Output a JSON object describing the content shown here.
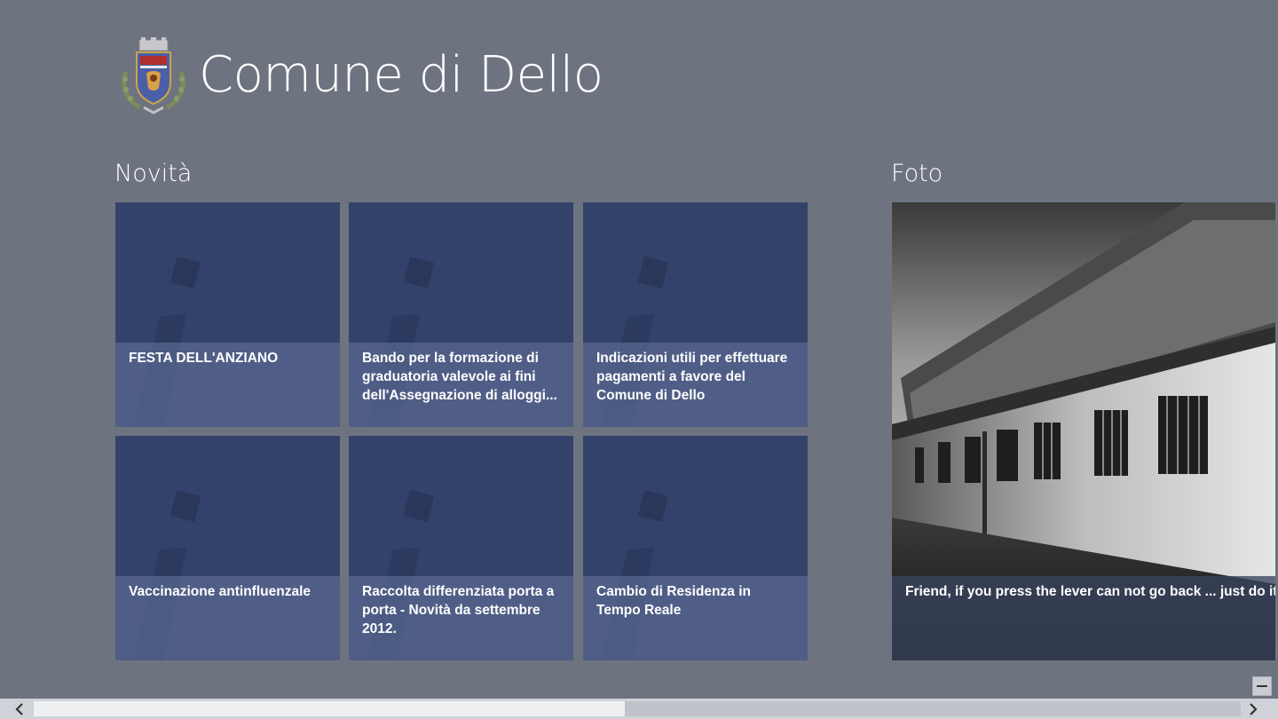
{
  "app": {
    "title": "Comune di Dello"
  },
  "sections": {
    "news": {
      "title": "Novità",
      "items": [
        {
          "title": "FESTA DELL'ANZIANO"
        },
        {
          "title": "Bando per la formazione di graduatoria valevole ai fini dell'Assegnazione di alloggi..."
        },
        {
          "title": "Indicazioni utili per effettuare pagamenti a favore del Comune di Dello"
        },
        {
          "title": "Vaccinazione antinfluenzale"
        },
        {
          "title": "Raccolta differenziata porta a porta - Novità da settembre 2012."
        },
        {
          "title": "Cambio di Residenza in Tempo Reale"
        }
      ]
    },
    "photos": {
      "title": "Foto",
      "items": [
        {
          "caption": "Friend, if you press the lever can not go back ... just do it!"
        }
      ]
    }
  },
  "scrollbar": {
    "position_fraction": 0.49
  },
  "icons": {
    "crest": "municipal-crest-logo",
    "tile_art": "info-i-icon",
    "zoom": "semantic-zoom-minus-icon",
    "scroll_left": "chevron-left-icon",
    "scroll_right": "chevron-right-icon"
  },
  "colors": {
    "background": "#6e7380",
    "tile": "#33426a",
    "tile_caption": "#68769e",
    "text": "#ffffff"
  }
}
